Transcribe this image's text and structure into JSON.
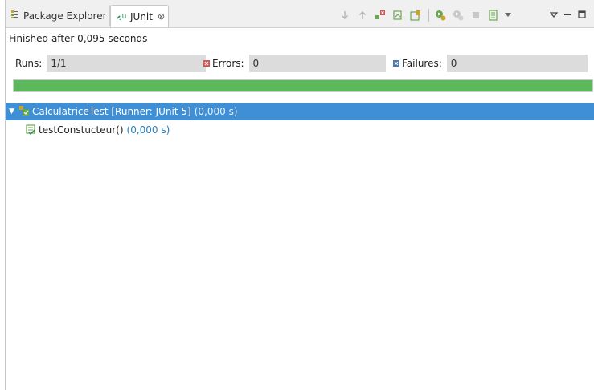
{
  "tabs": [
    {
      "label": "Package Explorer",
      "icon": "package-explorer-icon"
    },
    {
      "label": "JUnit",
      "icon": "junit-icon",
      "close": "⊗"
    }
  ],
  "status": "Finished after 0,095 seconds",
  "counters": {
    "runs": {
      "label": "Runs:",
      "value": "1/1"
    },
    "errors": {
      "label": "Errors:",
      "value": "0"
    },
    "failures": {
      "label": "Failures:",
      "value": "0"
    }
  },
  "progress": {
    "fraction": 1.0,
    "color": "#5cb85c"
  },
  "tree": {
    "suite": {
      "label": "CalculatriceTest [Runner: JUnit 5]",
      "time": "(0,000 s)",
      "expanded": true
    },
    "tests": [
      {
        "label": "testConstucteur()",
        "time": "(0,000 s)"
      }
    ]
  },
  "colors": {
    "selection": "#3f8fd6",
    "timing": "#2a7fb8",
    "error": "#d9534f",
    "failure": "#4a79b5"
  }
}
